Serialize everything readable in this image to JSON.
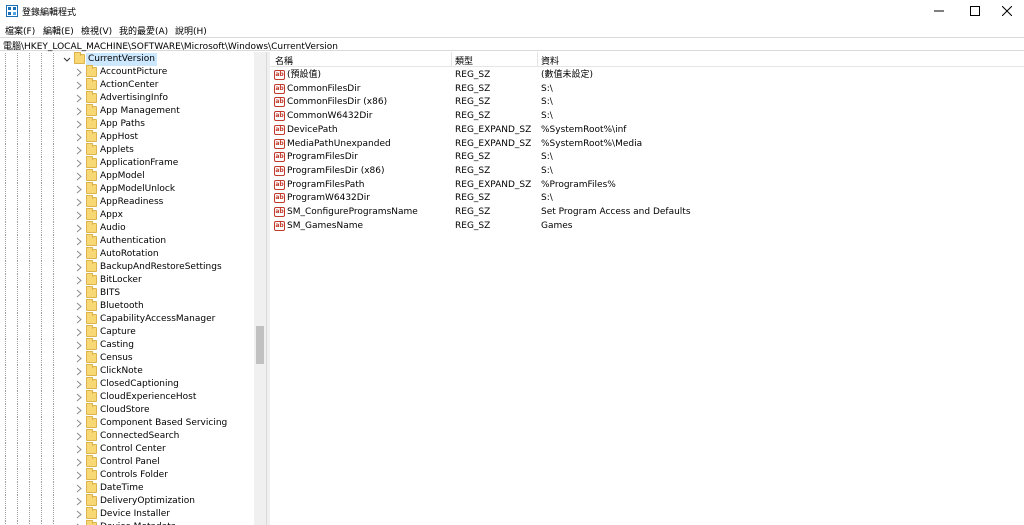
{
  "window": {
    "title": "登錄編輯程式"
  },
  "menu": [
    "檔案(F)",
    "編輯(E)",
    "檢視(V)",
    "我的最愛(A)",
    "說明(H)"
  ],
  "address": "電腦\\HKEY_LOCAL_MACHINE\\SOFTWARE\\Microsoft\\Windows\\CurrentVersion",
  "tree": {
    "selected": "CurrentVersion",
    "children": [
      "AccountPicture",
      "ActionCenter",
      "AdvertisingInfo",
      "App Management",
      "App Paths",
      "AppHost",
      "Applets",
      "ApplicationFrame",
      "AppModel",
      "AppModelUnlock",
      "AppReadiness",
      "Appx",
      "Audio",
      "Authentication",
      "AutoRotation",
      "BackupAndRestoreSettings",
      "BitLocker",
      "BITS",
      "Bluetooth",
      "CapabilityAccessManager",
      "Capture",
      "Casting",
      "Census",
      "ClickNote",
      "ClosedCaptioning",
      "CloudExperienceHost",
      "CloudStore",
      "Component Based Servicing",
      "ConnectedSearch",
      "Control Center",
      "Control Panel",
      "Controls Folder",
      "DateTime",
      "DeliveryOptimization",
      "Device Installer",
      "Device Metadata"
    ]
  },
  "columns": {
    "name": "名稱",
    "type": "類型",
    "data": "資料"
  },
  "values": [
    {
      "name": "(預設值)",
      "type": "REG_SZ",
      "data": "(數值未設定)"
    },
    {
      "name": "CommonFilesDir",
      "type": "REG_SZ",
      "data": "S:\\"
    },
    {
      "name": "CommonFilesDir (x86)",
      "type": "REG_SZ",
      "data": "S:\\"
    },
    {
      "name": "CommonW6432Dir",
      "type": "REG_SZ",
      "data": "S:\\"
    },
    {
      "name": "DevicePath",
      "type": "REG_EXPAND_SZ",
      "data": "%SystemRoot%\\inf"
    },
    {
      "name": "MediaPathUnexpanded",
      "type": "REG_EXPAND_SZ",
      "data": "%SystemRoot%\\Media"
    },
    {
      "name": "ProgramFilesDir",
      "type": "REG_SZ",
      "data": "S:\\"
    },
    {
      "name": "ProgramFilesDir (x86)",
      "type": "REG_SZ",
      "data": "S:\\"
    },
    {
      "name": "ProgramFilesPath",
      "type": "REG_EXPAND_SZ",
      "data": "%ProgramFiles%"
    },
    {
      "name": "ProgramW6432Dir",
      "type": "REG_SZ",
      "data": "S:\\"
    },
    {
      "name": "SM_ConfigureProgramsName",
      "type": "REG_SZ",
      "data": "Set Program Access and Defaults"
    },
    {
      "name": "SM_GamesName",
      "type": "REG_SZ",
      "data": "Games"
    }
  ],
  "icons": {
    "value_icon": "string-value-icon",
    "folder_icon": "folder-icon"
  }
}
